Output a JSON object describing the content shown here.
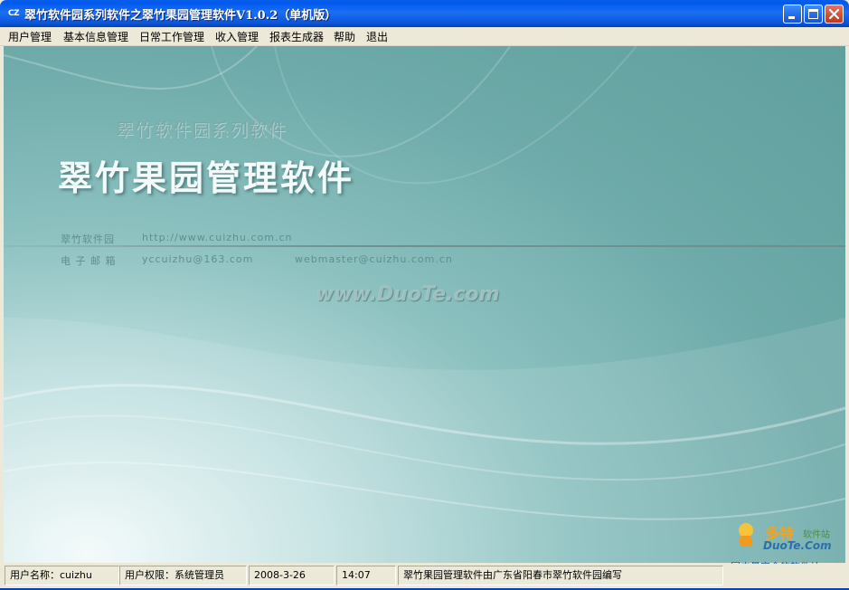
{
  "window": {
    "icon_text": "CZ",
    "title": "翠竹软件园系列软件之翠竹果园管理软件V1.0.2（单机版）"
  },
  "menu": {
    "items": [
      "用户管理",
      "基本信息管理",
      "日常工作管理",
      "收入管理",
      "报表生成器",
      "帮助",
      "退出"
    ]
  },
  "splash": {
    "series_name": "翠竹软件园系列软件",
    "app_name": "翠竹果园管理软件",
    "site_label": "翠竹软件园",
    "site_url": "http://www.cuizhu.com.cn",
    "email_label": "电 子 邮 箱",
    "email_primary": "yccuizhu@163.com",
    "email_secondary": "webmaster@cuizhu.com.cn",
    "watermark": "www.DuoTe.com"
  },
  "corner_logo": {
    "brand": "多特",
    "sub": "软件站",
    "domain": "DuoTe.Com",
    "slogan": "国内最安全的软件站"
  },
  "status": {
    "user": "用户名称：cuizhu",
    "permission": "用户权限：系统管理员",
    "date": "2008-3-26",
    "time": "14:07",
    "info": "翠竹果园管理软件由广东省阳春市翠竹软件园编写"
  },
  "colors": {
    "titlebar": "#0A5FE8",
    "chrome": "#ECE9D8",
    "splash_bg": "#6DAAA9"
  }
}
